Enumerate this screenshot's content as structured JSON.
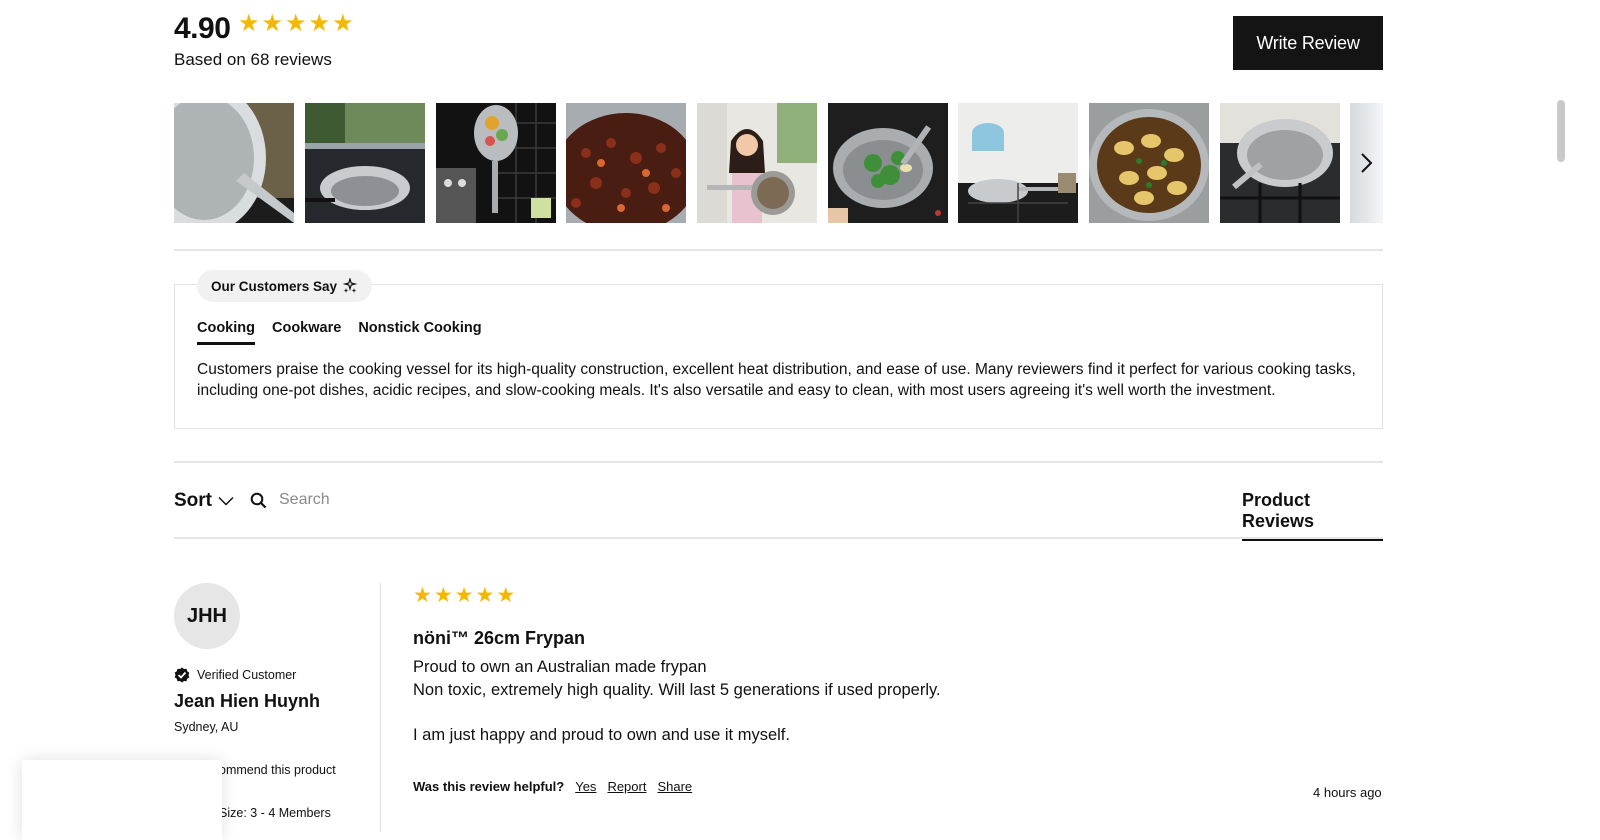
{
  "summary_header": {
    "rating": "4.90",
    "rating_stars": 5,
    "based_on": "Based on 68 reviews",
    "write_review": "Write Review"
  },
  "gallery": {
    "photos": [
      "pan-photo",
      "pan-on-stove-photo",
      "hanging-pan-photo",
      "bean-stew-photo",
      "girl-with-pan-photo",
      "greens-in-pan-photo",
      "pan-in-kitchen-photo",
      "ravioli-in-pan-photo",
      "pan-on-gas-stove-photo",
      "partial-photo"
    ],
    "next_icon": "chevron-right-icon"
  },
  "customers_say": {
    "title": "Our Customers Say",
    "tabs": [
      {
        "label": "Cooking",
        "active": true
      },
      {
        "label": "Cookware",
        "active": false
      },
      {
        "label": "Nonstick Cooking",
        "active": false
      }
    ],
    "summary": "Customers praise the cooking vessel for its high-quality construction, excellent heat distribution, and ease of use. Many reviewers find it perfect for various cooking tasks, including one-pot dishes, acidic recipes, and slow-cooking meals. It's also versatile and easy to clean, with most users agreeing it's well worth the investment."
  },
  "toolbar": {
    "sort_label": "Sort",
    "search_placeholder": "Search",
    "product_reviews_tab": "Product Reviews"
  },
  "review": {
    "initials": "JHH",
    "verified": "Verified Customer",
    "name": "Jean Hien Huynh",
    "location": "Sydney, AU",
    "recommend": "ommend this product",
    "family_size": "Size:   3 - 4 Members",
    "stars": 5,
    "title": "nöni™ 26cm Frypan",
    "body_line1": "Proud to own an Australian made frypan",
    "body_line2": "Non toxic, extremely high quality. Will last 5 generations if used properly.",
    "body_line3": "I am just happy and proud to own and use it myself.",
    "helpful_label": "Was this review helpful?",
    "yes": "Yes",
    "report": "Report",
    "share": "Share",
    "time": "4 hours ago"
  },
  "colors": {
    "star": "#f5b800",
    "button_bg": "#141414",
    "divider": "#e6e6e6"
  }
}
